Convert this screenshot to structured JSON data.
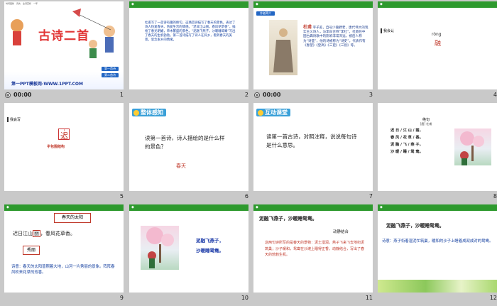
{
  "slides": [
    {
      "num": "1",
      "time": "00:00",
      "title": "古诗二首",
      "footer": "第一PPT模板网-WWW.1PPT.COM",
      "top_tags": [
        "时间更新",
        "诗文",
        "全诗赏析",
        "一年"
      ],
      "btn1": "第一首诗",
      "btn2": "第二首诗"
    },
    {
      "num": "2",
      "text": "杜甫写了一首诗有趣的绝句，这两首诗描写了春天的景色，表达了诗人热爱春天、热爱生活的情感。“迟日江山丽，春风花草香”，描绘了春光明媚，草木繁盛的景色，“泥融飞燕子，沙暖睡鸳鸯”写出了春天的生机勃勃。第二首诗描写了诗人在异乡，看到春天的美景，思念家乡的情绪。"
    },
    {
      "num": "3",
      "time": "00:00",
      "btn": "作者简介",
      "author": "杜甫",
      "bio": "字子美，自号少陵野老，唐代伟大的现实主义诗人，与李白合称“李杜”。杜甫在中国古典诗歌中的影响非常深远，被后人称为“诗圣”，他的诗被称为“诗史”。代表作有《春望》《登高》《三吏》《三别》等。"
    },
    {
      "num": "4",
      "label": "我会认",
      "pinyin": "róng",
      "char": "融"
    },
    {
      "num": "5",
      "label": "我会写",
      "char": "迟",
      "caption": "半包围结构"
    },
    {
      "num": "6",
      "tag": "整体感知",
      "question": "读第一首诗，诗人描绘的是什么样的景色？",
      "answer": "春天"
    },
    {
      "num": "7",
      "tag": "互动课堂",
      "question": "读第一首古诗，对照注释，说说每句诗是什么意思。"
    },
    {
      "num": "8",
      "poem_title": "绝句",
      "poem_author": "[唐] 杜甫",
      "lines": [
        "迟 日 / 江 山 / 丽，",
        "春 风 / 花 草 / 香。",
        "泥 融 / 飞 / 燕 子，",
        "沙 暖 / 睡 / 鸳 鸯。"
      ]
    },
    {
      "num": "9",
      "box1": "春天的太阳",
      "box2": "秀丽",
      "line1_a": "迟日江山",
      "line1_b": "丽",
      "line1_c": "，春风花草香。",
      "note": "诗意：春天的太阳普照着大地，山河一片秀丽的景象。阵阵春风吹来花草的芳香。"
    },
    {
      "num": "10",
      "lines": [
        "泥融飞燕子，",
        "沙暖睡鸳鸯。"
      ]
    },
    {
      "num": "11",
      "title": "泥融飞燕子，沙暖睡鸳鸯。",
      "sub": "动静结合",
      "text": "这两句诗所写的是春天的景物：泥土湿润，燕子飞来飞去地衔泥筑巢；沙子暖和，鸳鸯在沙滩上睡得正香。动静结合，写出了春天的勃勃生机。"
    },
    {
      "num": "12",
      "title": "泥融飞燕子，沙暖睡鸳鸯。",
      "meaning": "诗意：燕子衔着湿泥忙筑巢，暖和的沙子上睡着成双成对的鸳鸯。"
    }
  ]
}
